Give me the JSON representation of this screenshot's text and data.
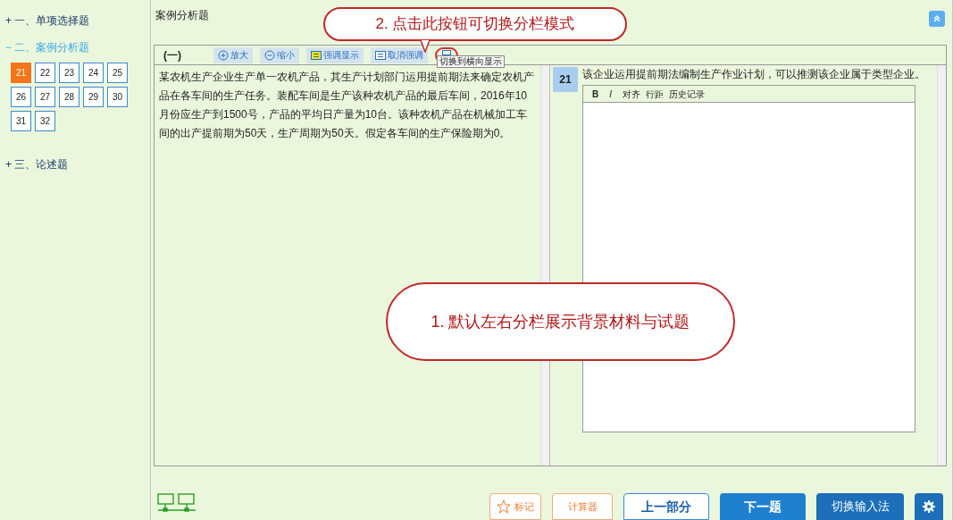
{
  "sidebar": {
    "sections": [
      {
        "toggle": "+",
        "label": "一、单项选择题",
        "expanded": false
      },
      {
        "toggle": "−",
        "label": "二、案例分析题",
        "expanded": true,
        "questions": [
          {
            "number": "21",
            "selected": true
          },
          {
            "number": "22",
            "selected": false
          },
          {
            "number": "23",
            "selected": false
          },
          {
            "number": "24",
            "selected": false
          },
          {
            "number": "25",
            "selected": false
          },
          {
            "number": "26",
            "selected": false
          },
          {
            "number": "27",
            "selected": false
          },
          {
            "number": "28",
            "selected": false
          },
          {
            "number": "29",
            "selected": false
          },
          {
            "number": "30",
            "selected": false
          },
          {
            "number": "31",
            "selected": false
          },
          {
            "number": "32",
            "selected": false
          }
        ]
      },
      {
        "toggle": "+",
        "label": "三、论述题",
        "expanded": false
      }
    ]
  },
  "main": {
    "title": "案例分析题",
    "toolbar": {
      "part": "(一)",
      "buttons": [
        {
          "kind": "zoom-in",
          "label": "放大"
        },
        {
          "kind": "zoom-out",
          "label": "缩小"
        },
        {
          "kind": "highlight",
          "label": "强调显示"
        },
        {
          "kind": "unhighlight",
          "label": "取消强调"
        },
        {
          "kind": "layout"
        }
      ],
      "tooltip": "切换到横向显示"
    },
    "material": "某农机生产企业生产单一农机产品，其生产计划部门运用提前期法来确定农机产品在各车间的生产任务。装配车间是生产该种农机产品的最后车间，2016年10月份应生产到1500号，产品的平均日产量为10台。该种农机产品在机械加工车间的出产提前期为50天，生产周期为50天。假定各车间的生产保险期为0。",
    "question": {
      "number": "21",
      "text": "该企业运用提前期法编制生产作业计划，可以推测该企业属于类型企业。",
      "editor_tools": [
        "B",
        "I",
        "对齐",
        "行距",
        "历史记录"
      ]
    }
  },
  "callouts": [
    {
      "kind": "top",
      "text": "2. 点击此按钮可切换分栏模式"
    },
    {
      "kind": "middle",
      "text": "1. 默认左右分栏展示背景材料与试题"
    }
  ],
  "bottom_bar": {
    "buttons": [
      {
        "kind": "mark",
        "label": "标记"
      },
      {
        "kind": "calculator",
        "label": "计算器"
      },
      {
        "kind": "previous",
        "label": "上一部分"
      },
      {
        "kind": "next",
        "label": "下一题"
      },
      {
        "kind": "input-method",
        "label": "切换输入法"
      },
      {
        "kind": "settings"
      }
    ]
  }
}
